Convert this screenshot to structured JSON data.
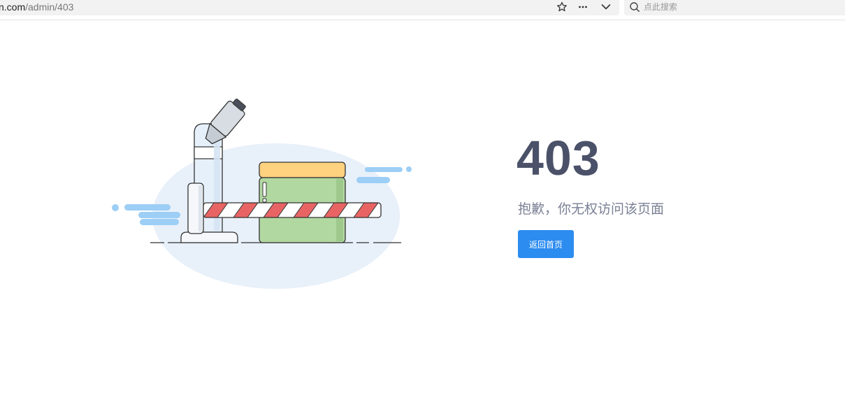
{
  "browser": {
    "url_host": "n.com",
    "url_path": "/admin/403",
    "search_placeholder": "点此搜索",
    "icons": [
      "star-icon",
      "more-icon",
      "chevron-down-icon",
      "search-icon"
    ]
  },
  "main": {
    "code": "403",
    "message": "抱歉，你无权访问该页面",
    "button_label": "返回首页"
  },
  "colors": {
    "accent": "#2d8cf0",
    "code_text": "#4a5169",
    "message_text": "#7a8095",
    "ellipse_bg": "#e8f0fa",
    "cloud": "#9dcef5",
    "barrier_red": "#e86464",
    "box_green": "#b2d8a2",
    "box_lid": "#ffd27f"
  }
}
